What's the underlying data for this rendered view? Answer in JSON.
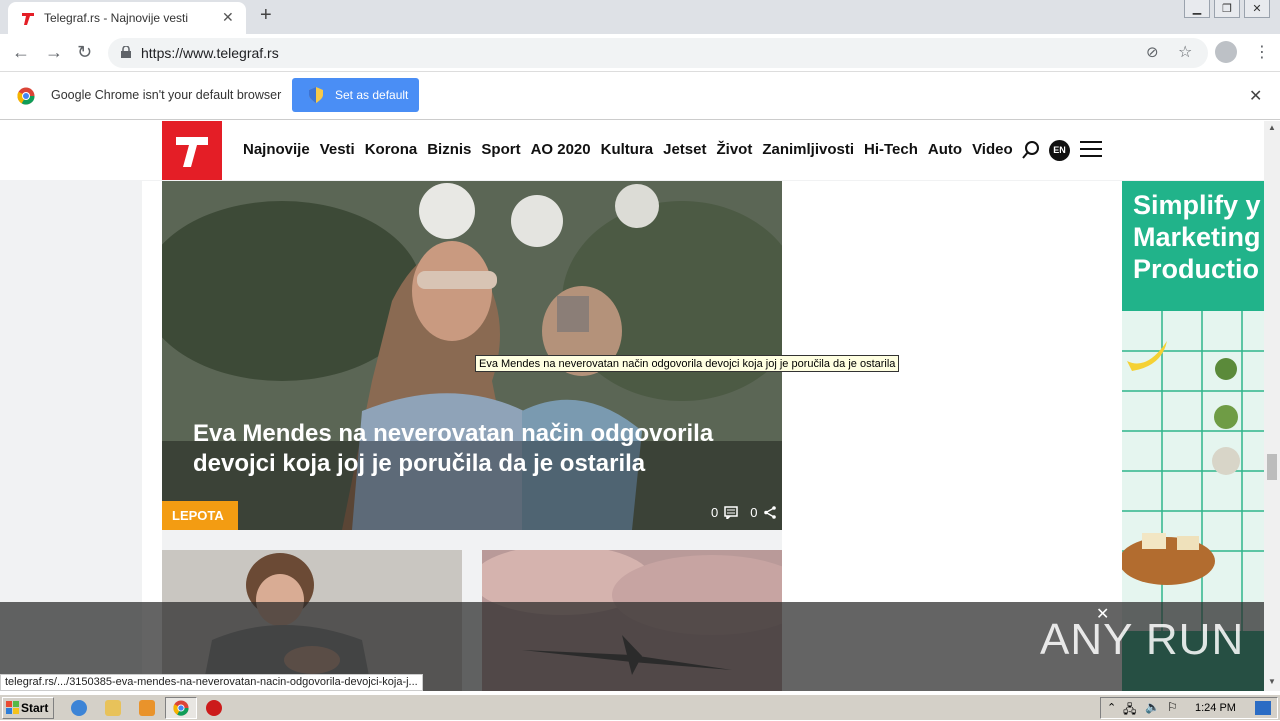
{
  "browser": {
    "tab_title": "Telegraf.rs - Najnovije vesti",
    "url": "https://www.telegraf.rs",
    "infobar_text": "Google Chrome isn't your default browser",
    "default_button_label": "Set as default",
    "status_url": "telegraf.rs/.../3150385-eva-mendes-na-neverovatan-nacin-odgovorila-devojci-koja-j..."
  },
  "site": {
    "menu": [
      "Najnovije",
      "Vesti",
      "Korona",
      "Biznis",
      "Sport",
      "AO 2020",
      "Kultura",
      "Jetset",
      "Život",
      "Zanimljivosti",
      "Hi-Tech",
      "Auto",
      "Video"
    ],
    "lang_badge": "EN",
    "hero": {
      "title": "Eva Mendes na neverovatan način odgovorila devojci koja joj je poručila da je ostarila",
      "tag": "LEPOTA",
      "comments": "0",
      "shares": "0",
      "tooltip": "Eva Mendes na neverovatan način odgovorila devojci koja joj je poručila da je ostarila"
    },
    "ad_text": [
      "Simplify y",
      "Marketing",
      "Productio"
    ]
  },
  "watermark": "ANY RUN",
  "taskbar": {
    "start_label": "Start",
    "clock": "1:24 PM"
  },
  "colors": {
    "brand_red": "#e41e26",
    "tag_orange": "#f39c12",
    "ad_green": "#21b38a",
    "chrome_blue": "#4a8ef5"
  }
}
